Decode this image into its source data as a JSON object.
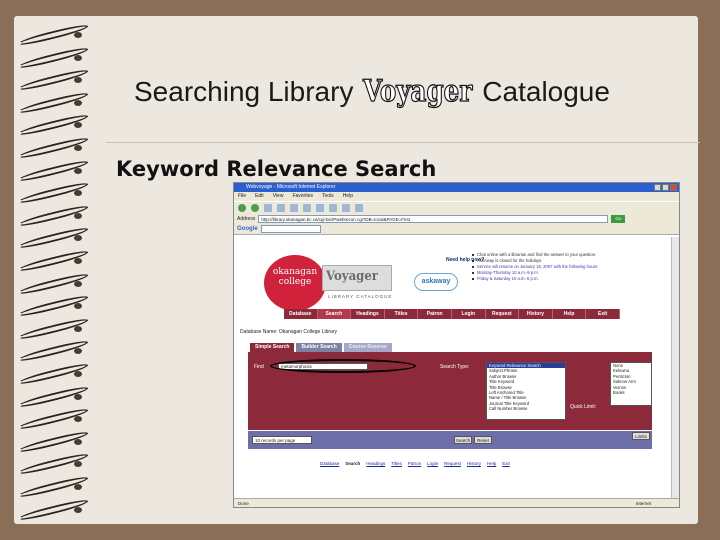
{
  "slide": {
    "title_before": "Searching Library",
    "title_logo": "Voyager",
    "title_after": "Catalogue",
    "subtitle": "Keyword Relevance Search"
  },
  "browser": {
    "window_title": "Webvoyage - Microsoft Internet Explorer",
    "menu": [
      "File",
      "Edit",
      "View",
      "Favorites",
      "Tools",
      "Help"
    ],
    "address_label": "Address",
    "url": "http://library.okanagan.bc.ca/cgi-bin/Pwebrecon.cgi?DB=local&PAGE=First",
    "go_label": "Go",
    "google_label": "Google",
    "status_text": "Done",
    "zone_text": "Internet"
  },
  "voyager": {
    "college_logo": "okanagan college",
    "voyager_logo": "Voyager",
    "voyager_sub": "LIBRARY CATALOGUE",
    "need_help": "Need help now?",
    "askaway": "askaway",
    "bullets": [
      "Chat online with a librarian and find the answer to your question.",
      "AskAway is closed for the holidays.",
      "Service will resume on January 15, 2007 with the following hours:",
      "Monday-Thursday 10 a.m.-9 p.m.",
      "Friday & Saturday 10 a.m.-5 p.m."
    ],
    "nav": [
      "Database",
      "Search",
      "Headings",
      "Titles",
      "Patron",
      "Login",
      "Request",
      "History",
      "Help",
      "Exit"
    ],
    "database_name": "Database Name: Okanagan College Library",
    "tabs": [
      "Simple Search",
      "Builder Search",
      "Course Reserve"
    ],
    "find_label": "Find",
    "find_value": "metamorphosis",
    "search_type_label": "Search Type:",
    "search_types": [
      "Keyword Relevance Search",
      "Subject Phrase",
      "Author Browse",
      "Title Keyword",
      "Title Browse",
      "Left Anchored Title",
      "Name / Title Browse",
      "Journal Title Keyword",
      "Call Number Browse"
    ],
    "quick_limit_label": "Quick Limit:",
    "quick_limits": [
      "None",
      "Kelowna",
      "Penticton",
      "Salmon Arm",
      "Vernon",
      "Books"
    ],
    "limits_label": "Limits",
    "per_page": "10 records per page",
    "search_btn": "Search",
    "reset_btn": "Reset",
    "footer_links": [
      "Database",
      "Search",
      "Headings",
      "Titles",
      "Patron",
      "Login",
      "Request",
      "History",
      "Help",
      "Exit"
    ]
  }
}
